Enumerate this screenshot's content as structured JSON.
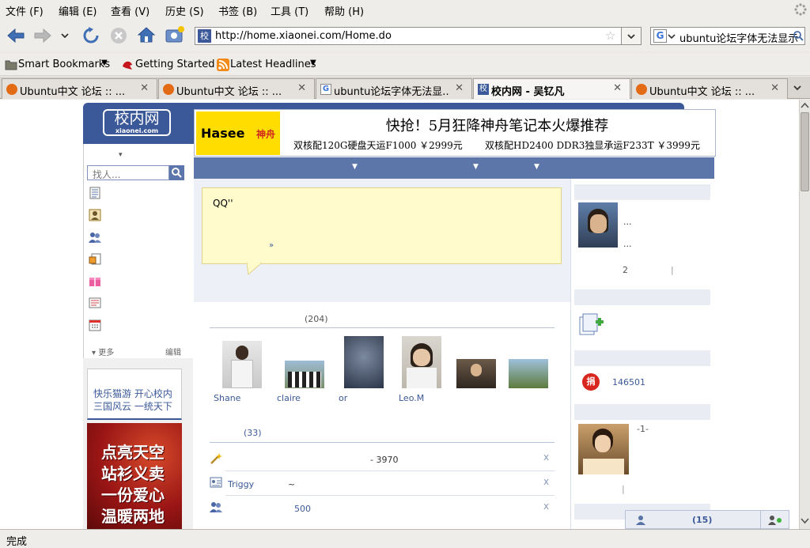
{
  "menu": [
    "文件 (F)",
    "编辑 (E)",
    "查看 (V)",
    "历史 (S)",
    "书签 (B)",
    "工具 (T)",
    "帮助 (H)"
  ],
  "url": "http://home.xiaonei.com/Home.do",
  "search_text": "ubuntu论坛字体无法显示",
  "bookmarks": {
    "smart": "Smart Bookmarks",
    "started": "Getting Started",
    "headlines": "Latest Headlines"
  },
  "tabs": [
    {
      "title": "Ubuntu中文 论坛 :: ...",
      "close": "✕"
    },
    {
      "title": "Ubuntu中文 论坛 :: ...",
      "close": "✕"
    },
    {
      "title": "ubuntu论坛字体无法显...",
      "close": "✕"
    },
    {
      "title": "校内网 - 吴钇凡",
      "close": "✕"
    },
    {
      "title": "Ubuntu中文 论坛 :: ...",
      "close": "✕"
    }
  ],
  "site": {
    "logo_cn": "校内网",
    "logo_en": "xiaonei.com",
    "search_placeholder": "找人...",
    "more": "▾ 更多",
    "edit": "编辑",
    "promo_line1": "快乐猫游 开心校内",
    "promo_line2": "三国风云 一统天下",
    "charity": [
      "点亮天空",
      "站衫义卖",
      "一份爱心",
      "温暖两地"
    ]
  },
  "banner": {
    "brand": "Hasee",
    "brand_cn": "神舟",
    "headline": "快抢！5月狂降神舟笔记本火爆推荐",
    "line1": "双核配120G硬盘天运F1000 ￥2999元",
    "line2": "双核配HD2400 DDR3独显承运F233T ￥3999元"
  },
  "status_bubble": {
    "text": "QQ''",
    "more": "»"
  },
  "friends": {
    "count": "(204)",
    "names": [
      "Shane",
      "claire",
      "or",
      "Leo.M",
      "",
      ""
    ]
  },
  "feed": {
    "count": "(33)",
    "items": [
      {
        "text": "- 3970",
        "close": "x"
      },
      {
        "name": "Triggy",
        "text": "~",
        "close": "x"
      },
      {
        "text": "500",
        "close": "x"
      }
    ]
  },
  "right": {
    "profile_line1": "...",
    "profile_line2": "...",
    "visit_count": "2",
    "divider": "|",
    "donation": "146501",
    "donate_badge": "捐",
    "second_caption": "-1-",
    "bottom_divider": "|"
  },
  "chatbar": {
    "count": "(15)"
  },
  "statusbar": "完成",
  "colors": {
    "brand": "#3b5998",
    "ad_yellow": "#ffdd00",
    "bubble": "#fffbcc"
  }
}
